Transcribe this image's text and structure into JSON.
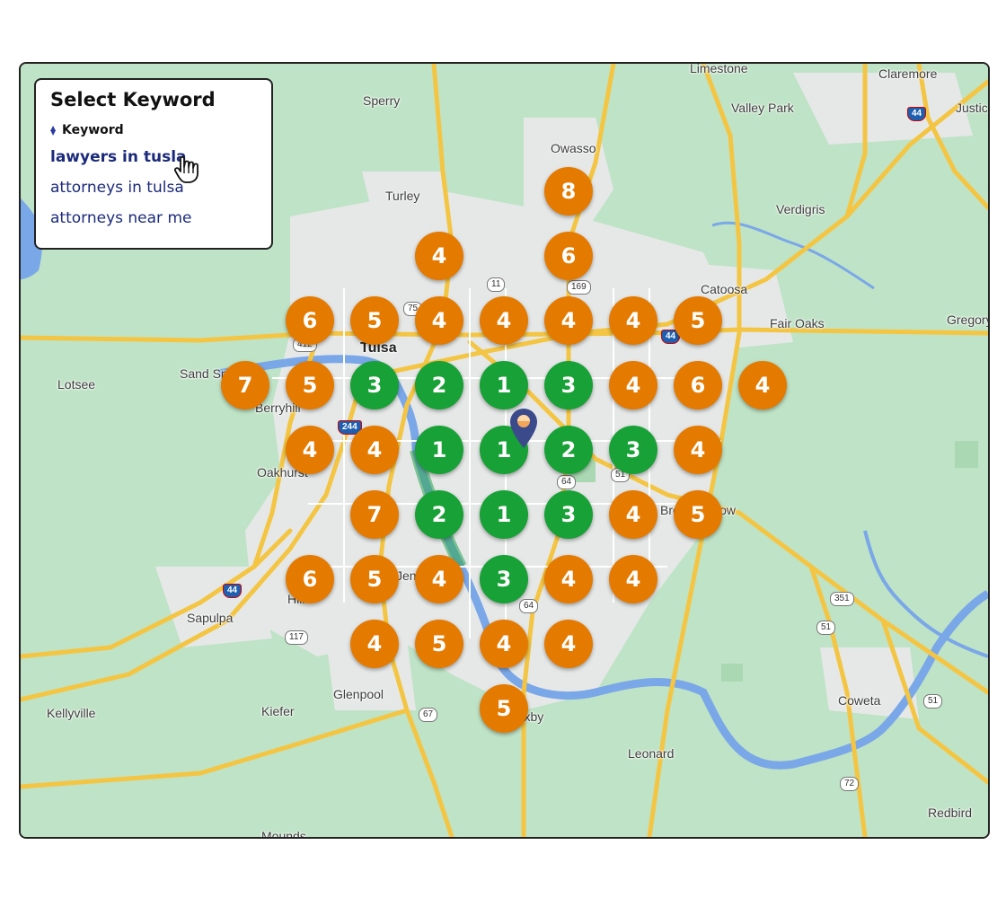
{
  "panel": {
    "title": "Select Keyword",
    "column_header": "Keyword",
    "keywords": [
      "lawyers in tusla",
      "attorneys in tulsa",
      "attorneys near me"
    ],
    "selected_index": 0
  },
  "map": {
    "center_city": "Tulsa",
    "places": [
      "Limestone",
      "Claremore",
      "Justic",
      "Sperry",
      "Valley Park",
      "Owasso",
      "Turley",
      "Verdigris",
      "Catoosa",
      "Fair Oaks",
      "Gregory",
      "Sand Springs",
      "Lotsee",
      "Berryhill",
      "Oakhurst",
      "Broken Arrow",
      "Jenks",
      "Hill",
      "Sapulpa",
      "Glenpool",
      "Kiefer",
      "Bixby",
      "Kellyville",
      "Leonard",
      "Coweta",
      "Redbird",
      "Mounds"
    ],
    "route_shields": [
      "75",
      "11",
      "169",
      "412",
      "44",
      "244",
      "51",
      "64",
      "117",
      "67",
      "351",
      "72"
    ],
    "center_pin_icon": "location-pin-icon"
  },
  "grid_ranks": [
    {
      "rank": "8"
    },
    {
      "rank": "4"
    },
    {
      "rank": "6"
    },
    {
      "rank": "6"
    },
    {
      "rank": "5"
    },
    {
      "rank": "4"
    },
    {
      "rank": "4"
    },
    {
      "rank": "4"
    },
    {
      "rank": "4"
    },
    {
      "rank": "5"
    },
    {
      "rank": "7"
    },
    {
      "rank": "5"
    },
    {
      "rank": "3"
    },
    {
      "rank": "2"
    },
    {
      "rank": "1"
    },
    {
      "rank": "3"
    },
    {
      "rank": "4"
    },
    {
      "rank": "6"
    },
    {
      "rank": "4"
    },
    {
      "rank": "4"
    },
    {
      "rank": "4"
    },
    {
      "rank": "1"
    },
    {
      "rank": "1"
    },
    {
      "rank": "2"
    },
    {
      "rank": "3"
    },
    {
      "rank": "4"
    },
    {
      "rank": "7"
    },
    {
      "rank": "2"
    },
    {
      "rank": "1"
    },
    {
      "rank": "3"
    },
    {
      "rank": "4"
    },
    {
      "rank": "5"
    },
    {
      "rank": "6"
    },
    {
      "rank": "5"
    },
    {
      "rank": "4"
    },
    {
      "rank": "3"
    },
    {
      "rank": "4"
    },
    {
      "rank": "4"
    },
    {
      "rank": "4"
    },
    {
      "rank": "5"
    },
    {
      "rank": "4"
    },
    {
      "rank": "4"
    },
    {
      "rank": "5"
    }
  ],
  "colors": {
    "top_rank": "#17a136",
    "lower_rank": "#e57a00",
    "map_land": "#bfe3c6",
    "urban": "#e6e8e8",
    "highway": "#f4c542",
    "water": "#7aa7e8",
    "keyword_link": "#1b2a7a",
    "pin": "#3b4a8a"
  },
  "icons": {
    "sort": "sort-icon",
    "cursor": "hand-pointer-icon"
  }
}
